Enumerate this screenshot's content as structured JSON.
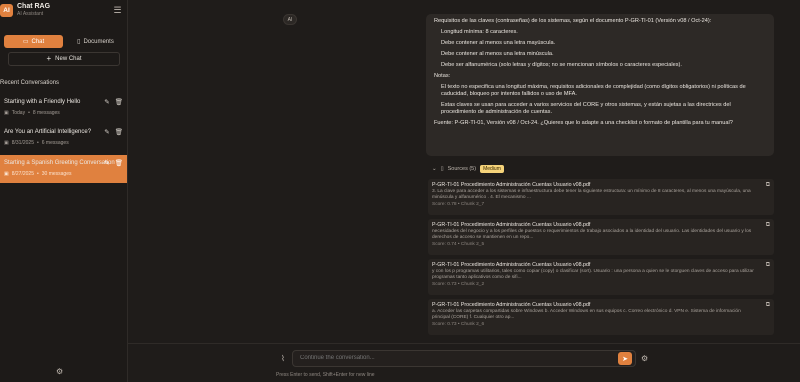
{
  "app": {
    "title": "Chat RAG",
    "subtitle": "AI Assistant",
    "logo": "AI"
  },
  "sidebar": {
    "tabs": [
      {
        "label": "Chat",
        "icon": "chat-icon",
        "active": true
      },
      {
        "label": "Documents",
        "icon": "document-icon",
        "active": false
      }
    ],
    "new_chat_label": "New Chat",
    "recent_label": "Recent Conversations",
    "conversations": [
      {
        "title": "Starting with a Friendly Hello",
        "date": "Today",
        "messages": "8 messages"
      },
      {
        "title": "Are You an Artificial Intelligence?",
        "date": "8/31/2025",
        "messages": "6 messages"
      },
      {
        "title": "Starting a Spanish Greeting Conversation",
        "date": "8/27/2025",
        "messages": "30 messages"
      }
    ]
  },
  "main": {
    "ai_label": "AI",
    "answer": {
      "intro": "Requisitos de las claves (contraseñas) de los sistemas, según el documento P-GR-TI-01 (Versión v08 / Oct-24):",
      "requirements": [
        "Longitud mínima: 8 caracteres.",
        "Debe contener al menos una letra mayúscula.",
        "Debe contener al menos una letra minúscula.",
        "Debe ser alfanumérica (solo letras y dígitos; no se mencionan símbolos o caracteres especiales)."
      ],
      "notes_label": "Notas:",
      "notes": [
        "El texto no especifica una longitud máxima, requisitos adicionales de complejidad (como dígitos obligatorios) ni políticas de caducidad, bloqueo por intentos fallidos o uso de MFA.",
        "Estas claves se usan para acceder a varios servicios del CORE y otros sistemas, y están sujetas a las directrices del procedimiento de administración de cuentas."
      ],
      "source_line": "Fuente: P-GR-TI-01, Versión v08 / Oct-24. ¿Quieres que lo adapte a una checklist o formato de plantilla para tu manual?"
    },
    "sources": {
      "label": "Sources (5)",
      "confidence": "Medium",
      "items": [
        {
          "title": "P-GR-TI-01 Procedimiento Administración Cuentas Usuario v08.pdf",
          "text": "3. La clave para acceder a los sistemas e infraestructura debe tener la siguiente estructura: un mínimo de 8 caracteres, al menos una mayúscula, una minúscula y alfanumérico . 4. El mecanismo ...",
          "score": "Score: 0.78",
          "chunk": "Chunk 2_7"
        },
        {
          "title": "P-GR-TI-01 Procedimiento Administración Cuentas Usuario v08.pdf",
          "text": "necesidades del negocio y a los perfiles de puestos o requerimientos de trabajo asociados a la identidad del usuario. Las identidades del usuario y los derechos de acceso se mantienen en un repo...",
          "score": "Score: 0.74",
          "chunk": "Chunk 2_5"
        },
        {
          "title": "P-GR-TI-01 Procedimiento Administración Cuentas Usuario v08.pdf",
          "text": "y con los p programas utilitarios, tales como copiar (copy) o clasificar (sort). Usuario : una persona a quien se le otorguen claves de acceso para utilizar programas tanto aplicativos como de sifi...",
          "score": "Score: 0.73",
          "chunk": "Chunk 2_2"
        },
        {
          "title": "P-GR-TI-01 Procedimiento Administración Cuentas Usuario v08.pdf",
          "text": "a. Acceder las carpetas compartidas sobre Windows b. Acceder Windows en sus equipos c. Correo electrónico d. VPN e. Sistema de información principal (CORE) f. Cualquier otro ap...",
          "score": "Score: 0.73",
          "chunk": "Chunk 2_6"
        }
      ]
    },
    "composer": {
      "placeholder": "Continue the conversation...",
      "hint": "Press Enter to send, Shift+Enter for new line"
    }
  }
}
